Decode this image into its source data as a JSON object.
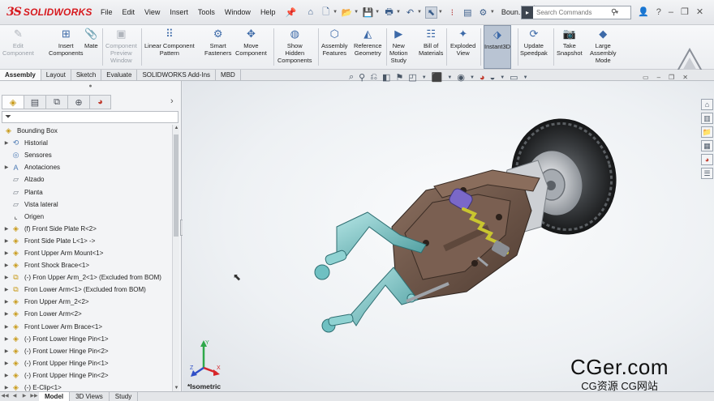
{
  "app": {
    "logo_ds": "3S",
    "logo_text": "SOLIDWORKS",
    "doc_name": "Boun..."
  },
  "menu": [
    "File",
    "Edit",
    "View",
    "Insert",
    "Tools",
    "Window",
    "Help"
  ],
  "search": {
    "placeholder": "Search Commands"
  },
  "ribbon": [
    {
      "label": "Edit\nComponent",
      "icon": "edit-component-icon",
      "disabled": true
    },
    {
      "label": "Insert\nComponents",
      "icon": "insert-components-icon",
      "disabled": false
    },
    {
      "label": "Mate",
      "icon": "mate-icon",
      "disabled": false
    },
    {
      "label": "Component\nPreview\nWindow",
      "icon": "preview-window-icon",
      "disabled": true
    },
    {
      "label": "Linear Component\nPattern",
      "icon": "linear-pattern-icon",
      "disabled": false
    },
    {
      "label": "Smart\nFasteners",
      "icon": "smart-fasteners-icon",
      "disabled": false
    },
    {
      "label": "Move\nComponent",
      "icon": "move-component-icon",
      "disabled": false
    },
    {
      "label": "Show\nHidden\nComponents",
      "icon": "show-hidden-icon",
      "disabled": false
    },
    {
      "label": "Assembly\nFeatures",
      "icon": "assembly-features-icon",
      "disabled": false
    },
    {
      "label": "Reference\nGeometry",
      "icon": "reference-geometry-icon",
      "disabled": false
    },
    {
      "label": "New\nMotion\nStudy",
      "icon": "motion-study-icon",
      "disabled": false
    },
    {
      "label": "Bill of\nMaterials",
      "icon": "bom-icon",
      "disabled": false
    },
    {
      "label": "Exploded\nView",
      "icon": "exploded-view-icon",
      "disabled": false
    },
    {
      "label": "Instant3D",
      "icon": "instant3d-icon",
      "disabled": false,
      "active": true
    },
    {
      "label": "Update\nSpeedpak",
      "icon": "speedpak-icon",
      "disabled": false
    },
    {
      "label": "Take\nSnapshot",
      "icon": "snapshot-icon",
      "disabled": false
    },
    {
      "label": "Large\nAssembly\nMode",
      "icon": "large-assembly-icon",
      "disabled": false
    }
  ],
  "tabs": [
    "Assembly",
    "Layout",
    "Sketch",
    "Evaluate",
    "SOLIDWORKS Add-Ins",
    "MBD"
  ],
  "active_tab": "Assembly",
  "tree": {
    "root": "Bounding Box",
    "items": [
      {
        "label": "Historial",
        "icon": "history-icon",
        "expandable": true
      },
      {
        "label": "Sensores",
        "icon": "sensor-icon",
        "expandable": false
      },
      {
        "label": "Anotaciones",
        "icon": "annotations-icon",
        "expandable": true
      },
      {
        "label": "Alzado",
        "icon": "plane-icon",
        "expandable": false
      },
      {
        "label": "Planta",
        "icon": "plane-icon",
        "expandable": false
      },
      {
        "label": "Vista lateral",
        "icon": "plane-icon",
        "expandable": false
      },
      {
        "label": "Origen",
        "icon": "origin-icon",
        "expandable": false
      },
      {
        "label": "(f) Front Side Plate R<2>",
        "icon": "part-icon",
        "expandable": true
      },
      {
        "label": "Front Side Plate L<1> ->",
        "icon": "part-icon",
        "expandable": true
      },
      {
        "label": "Front Upper Arm Mount<1>",
        "icon": "part-icon",
        "expandable": true
      },
      {
        "label": "Front Shock Brace<1>",
        "icon": "part-icon",
        "expandable": true
      },
      {
        "label": "(-) Fron Upper Arm_2<1> (Excluded from BOM)",
        "icon": "subassembly-icon",
        "expandable": true
      },
      {
        "label": "Fron Lower Arm<1> (Excluded from BOM)",
        "icon": "subassembly-icon",
        "expandable": true
      },
      {
        "label": "Fron Upper Arm_2<2>",
        "icon": "part-icon",
        "expandable": true
      },
      {
        "label": "Fron Lower Arm<2>",
        "icon": "part-icon",
        "expandable": true
      },
      {
        "label": "Front Lower Arm Brace<1>",
        "icon": "part-icon",
        "expandable": true
      },
      {
        "label": "(-) Front Lower Hinge Pin<1>",
        "icon": "part-icon",
        "expandable": true
      },
      {
        "label": "(-) Front Lower Hinge Pin<2>",
        "icon": "part-icon",
        "expandable": true
      },
      {
        "label": "(-) Front Upper Hinge Pin<1>",
        "icon": "part-icon",
        "expandable": true
      },
      {
        "label": "(-) Front Upper Hinge Pin<2>",
        "icon": "part-icon",
        "expandable": true
      },
      {
        "label": "(-) E-Clip<1>",
        "icon": "part-icon",
        "expandable": true
      }
    ]
  },
  "viewport": {
    "view_label": "*Isometric",
    "triad": {
      "x": "X",
      "y": "Y",
      "z": "Z"
    }
  },
  "watermark": {
    "main": "CGer.com",
    "sub": "CG资源 CG网站"
  },
  "bottom_tabs": [
    "Model",
    "3D Views",
    "Study"
  ],
  "active_bottom_tab": "Model",
  "colors": {
    "accent": "#d7191e",
    "part_icon": "#c89a18",
    "active_tool": "#b9c4d3",
    "model_bronze": "#6b5346",
    "model_teal": "#7fc4c4",
    "model_purple": "#7a68c8"
  }
}
